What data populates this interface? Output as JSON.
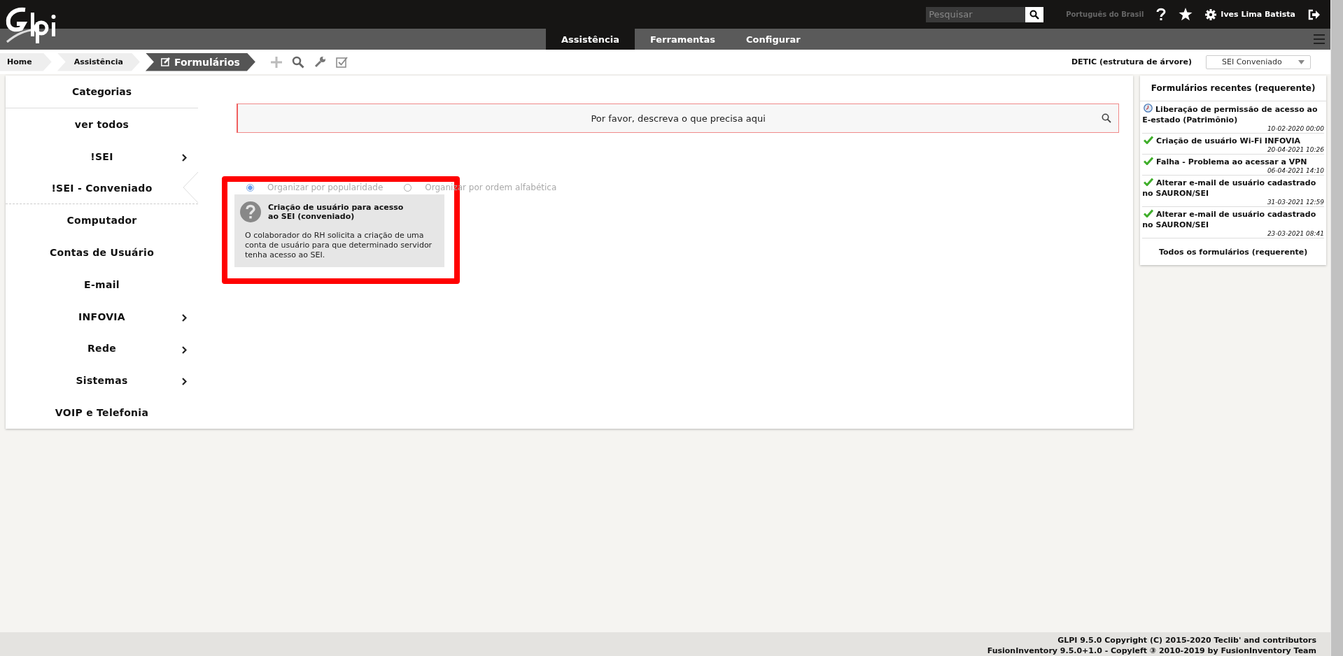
{
  "header": {
    "search": {
      "placeholder": "Pesquisar"
    },
    "language": "Português do Brasil",
    "user": "Ives Lima Batista"
  },
  "menu": [
    {
      "label": "Assistência",
      "selected": true
    },
    {
      "label": "Ferramentas",
      "selected": false
    },
    {
      "label": "Configurar",
      "selected": false
    }
  ],
  "breadcrumb": [
    {
      "label": "Home",
      "kind": "link"
    },
    {
      "label": "Assistência",
      "kind": "link"
    },
    {
      "label": "Formulários",
      "kind": "current"
    }
  ],
  "entity": {
    "label": "DETIC (estrutura de árvore)",
    "value": "SEI Conveniado"
  },
  "categories": {
    "title": "Categorias",
    "items": [
      {
        "label": "ver todos",
        "has_children": false,
        "selected": false
      },
      {
        "label": "!SEI",
        "has_children": true,
        "selected": false
      },
      {
        "label": "!SEI - Conveniado",
        "has_children": false,
        "selected": true
      },
      {
        "label": "Computador",
        "has_children": false,
        "selected": false
      },
      {
        "label": "Contas de Usuário",
        "has_children": false,
        "selected": false
      },
      {
        "label": "E-mail",
        "has_children": false,
        "selected": false
      },
      {
        "label": "INFOVIA",
        "has_children": true,
        "selected": false
      },
      {
        "label": "Rede",
        "has_children": true,
        "selected": false
      },
      {
        "label": "Sistemas",
        "has_children": true,
        "selected": false
      },
      {
        "label": "VOIP e Telefonia",
        "has_children": false,
        "selected": false
      }
    ]
  },
  "form_search": {
    "placeholder": "Por favor, descreva o que precisa aqui"
  },
  "sort_options": [
    {
      "label": "Organizar por popularidade",
      "selected": true
    },
    {
      "label": "Organizar por ordem alfabética",
      "selected": false
    }
  ],
  "forms": [
    {
      "title": "Criação de usuário para acesso ao SEI (conveniado)",
      "description": "O colaborador do RH solicita a criação de uma conta de usuário para que determinado servidor tenha acesso ao SEI."
    }
  ],
  "recent_forms": {
    "title": "Formulários recentes (requerente)",
    "items": [
      {
        "title": "Liberação de permissão de acesso ao E-estado (Patrimônio)",
        "date": "10-02-2020 00:00",
        "kind": "waiting"
      },
      {
        "title": "Criação de usuário Wi-Fi INFOVIA",
        "date": "20-04-2021 10:26",
        "kind": "done"
      },
      {
        "title": "Falha - Problema ao acessar a VPN",
        "date": "06-04-2021 14:10",
        "kind": "done"
      },
      {
        "title": "Alterar e-mail de usuário cadastrado no SAURON/SEI",
        "date": "31-03-2021 12:59",
        "kind": "done"
      },
      {
        "title": "Alterar e-mail de usuário cadastrado no SAURON/SEI",
        "date": "23-03-2021 08:41",
        "kind": "done"
      }
    ],
    "all_link": "Todos os formulários (requerente)"
  },
  "footer": [
    "GLPI 9.5.0 Copyright (C) 2015-2020 Teclib' and contributors",
    "FusionInventory 9.5.0+1.0 - Copyleft ③ 2010-2019 by FusionInventory Team"
  ]
}
